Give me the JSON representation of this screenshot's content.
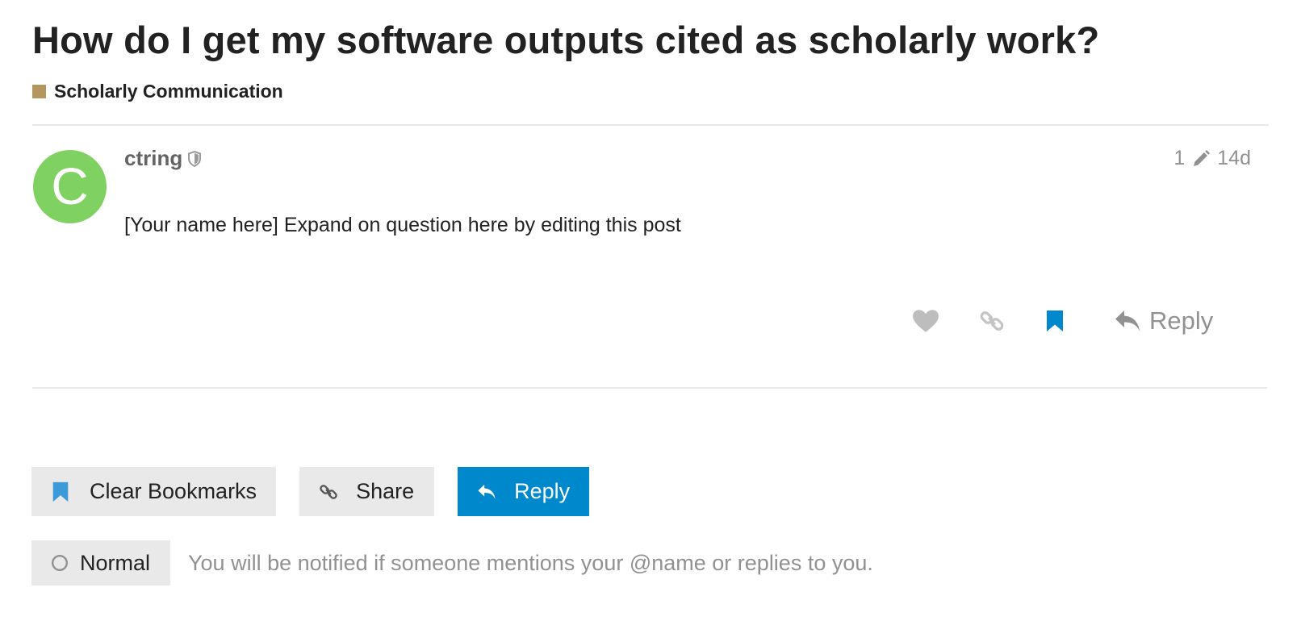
{
  "topic": {
    "title": "How do I get my software outputs cited as scholarly work?",
    "category": {
      "label": "Scholarly Communication",
      "color": "#b3975e"
    }
  },
  "post": {
    "avatar_letter": "C",
    "avatar_color": "#7fd161",
    "username": "ctring",
    "edit_count": "1",
    "age": "14d",
    "body": "[Your name here] Expand on question here by editing this post",
    "reply_label": "Reply"
  },
  "footer": {
    "clear_bookmarks_label": "Clear Bookmarks",
    "share_label": "Share",
    "reply_label": "Reply"
  },
  "notifications": {
    "level_label": "Normal",
    "description": "You will be notified if someone mentions your @name or replies to you."
  },
  "colors": {
    "accent": "#0088cc",
    "bookmark": "#0088cc",
    "muted": "#919191"
  }
}
